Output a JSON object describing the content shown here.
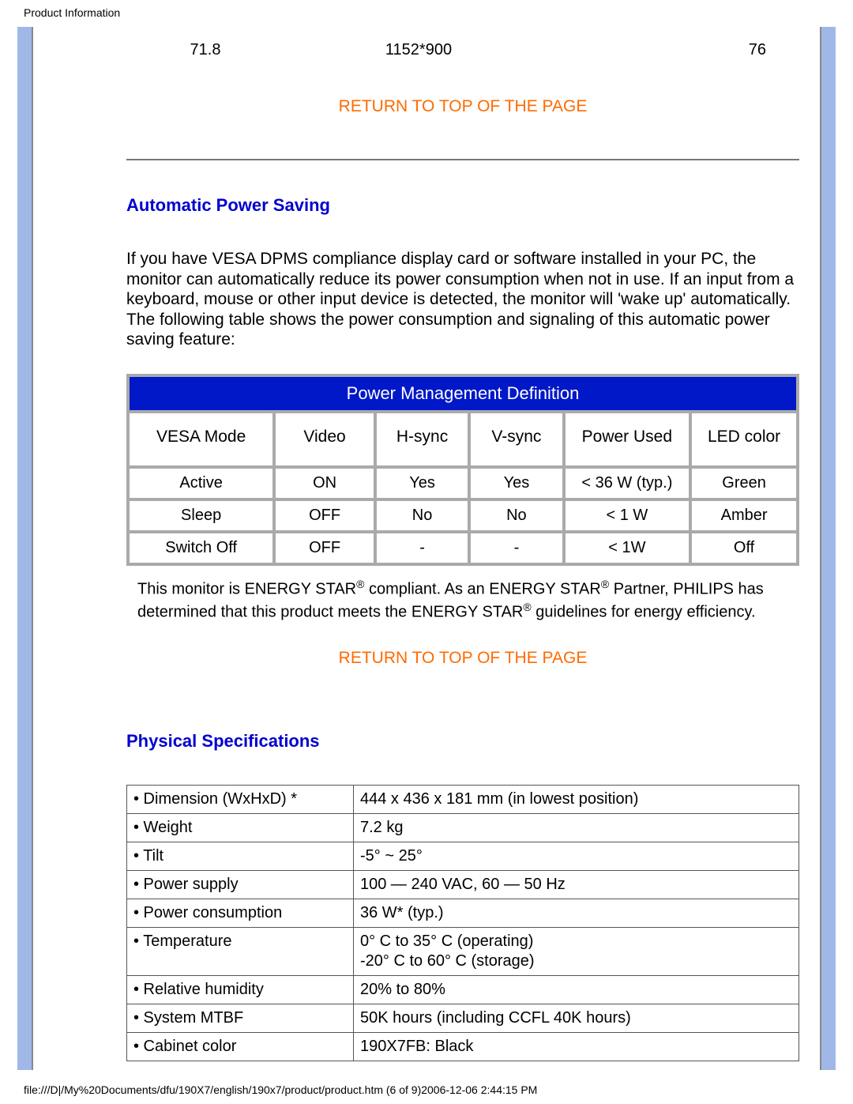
{
  "header": "Product Information",
  "footer": "file:///D|/My%20Documents/dfu/190X7/english/190x7/product/product.htm (6 of 9)2006-12-06 2:44:15 PM",
  "top_row": {
    "c1": "71.8",
    "c2": "1152*900",
    "c3": "76"
  },
  "links": {
    "return_top": "RETURN TO TOP OF THE PAGE"
  },
  "aps": {
    "heading": "Automatic Power Saving",
    "paragraph": "If you have VESA DPMS compliance display card or software installed in your PC, the monitor can automatically reduce its power consumption when not in use. If an input from a keyboard, mouse or other input device is detected, the monitor will 'wake up' automatically. The following table shows the power consumption and signaling of this automatic power saving feature:"
  },
  "pm_table": {
    "caption": "Power Management Definition",
    "headers": [
      "VESA Mode",
      "Video",
      "H-sync",
      "V-sync",
      "Power Used",
      "LED color"
    ],
    "rows": [
      [
        "Active",
        "ON",
        "Yes",
        "Yes",
        "< 36 W (typ.)",
        "Green"
      ],
      [
        "Sleep",
        "OFF",
        "No",
        "No",
        "< 1 W",
        "Amber"
      ],
      [
        "Switch Off",
        "OFF",
        "-",
        "-",
        "< 1W",
        "Off"
      ]
    ]
  },
  "energy_note": {
    "t1": "This monitor is ENERGY STAR",
    "t2": " compliant. As an ENERGY STAR",
    "t3": " Partner, PHILIPS has determined that this product meets the ENERGY STAR",
    "t4": " guidelines for energy efficiency.",
    "reg": "®"
  },
  "phys": {
    "heading": "Physical Specifications",
    "rows": [
      {
        "label": "• Dimension (WxHxD) *",
        "value": "444 x 436 x 181 mm (in lowest position)"
      },
      {
        "label": "• Weight",
        "value": "7.2 kg"
      },
      {
        "label": "• Tilt",
        "value": "-5° ~ 25°"
      },
      {
        "label": "• Power supply",
        "value": "100 — 240 VAC, 60 — 50 Hz"
      },
      {
        "label": "• Power consumption",
        "value": "36 W* (typ.)"
      },
      {
        "label": "• Temperature",
        "value": "0° C to 35° C (operating)\n-20° C to 60° C (storage)"
      },
      {
        "label": "• Relative humidity",
        "value": "20% to 80%"
      },
      {
        "label": "• System MTBF",
        "value": "50K hours (including CCFL 40K hours)"
      },
      {
        "label": "• Cabinet color",
        "value": "190X7FB: Black"
      }
    ]
  }
}
